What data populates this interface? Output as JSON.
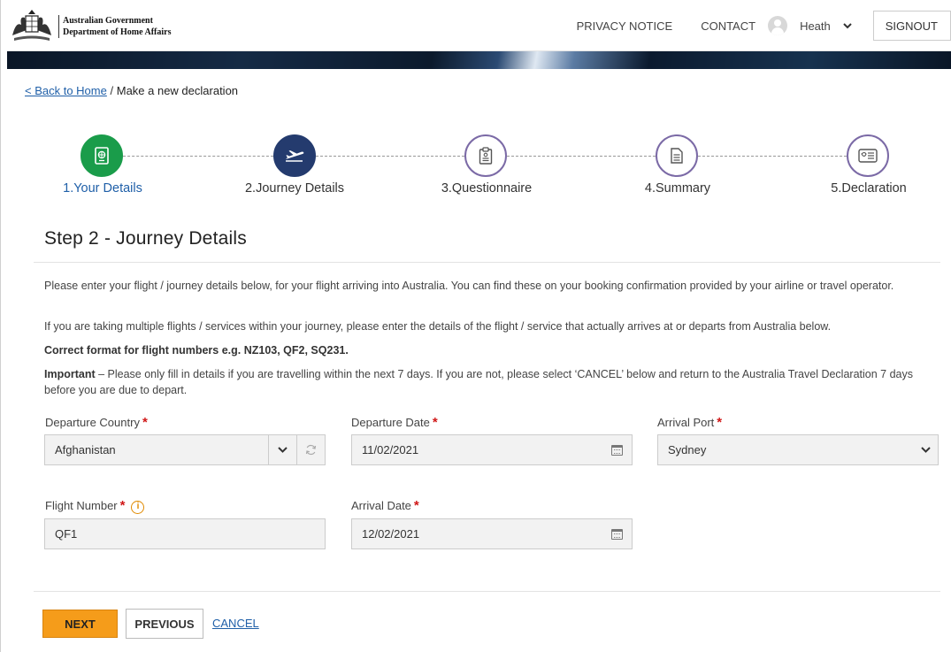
{
  "header": {
    "gov_name": "Australian Government",
    "dept_name": "Department of Home Affairs",
    "privacy_notice": "PRIVACY NOTICE",
    "contact": "CONTACT",
    "user_name": "Heath",
    "signout": "SIGNOUT"
  },
  "breadcrumb": {
    "back_link": "< Back to Home",
    "separator": "/",
    "current": "Make a new declaration"
  },
  "stepper": {
    "steps": [
      {
        "label": "1.Your Details",
        "state": "done",
        "icon": "passport-icon"
      },
      {
        "label": "2.Journey Details",
        "state": "active",
        "icon": "airplane-icon"
      },
      {
        "label": "3.Questionnaire",
        "state": "todo",
        "icon": "clipboard-icon"
      },
      {
        "label": "4.Summary",
        "state": "todo",
        "icon": "document-icon"
      },
      {
        "label": "5.Declaration",
        "state": "todo",
        "icon": "id-card-icon"
      }
    ]
  },
  "page_title": "Step 2 - Journey Details",
  "instructions": {
    "p1": "Please enter your flight / journey details below, for your flight arriving into Australia. You can find these on your booking confirmation provided by your airline or travel operator.",
    "p2": "If you are taking multiple flights / services within your journey, please enter the details of the flight / service that actually arrives at or departs from Australia below.",
    "p3": "Correct format for flight numbers e.g. NZ103, QF2, SQ231.",
    "p4_bold": "Important",
    "p4_rest": " – Please only fill in details if you are travelling within the next 7 days.  If you are not, please select ‘CANCEL’ below and return to the Australia Travel Declaration 7 days before you are due to depart."
  },
  "form": {
    "departure_country": {
      "label": "Departure Country",
      "value": "Afghanistan"
    },
    "departure_date": {
      "label": "Departure Date",
      "value": "11/02/2021"
    },
    "arrival_port": {
      "label": "Arrival Port",
      "value": "Sydney"
    },
    "flight_number": {
      "label": "Flight Number",
      "value": "QF1"
    },
    "arrival_date": {
      "label": "Arrival Date",
      "value": "12/02/2021"
    },
    "required_mark": "*",
    "info_mark": "i"
  },
  "actions": {
    "next": "NEXT",
    "previous": "PREVIOUS",
    "cancel": "CANCEL"
  },
  "colors": {
    "accent_orange": "#f59c1a",
    "step_done": "#1a9c4a",
    "step_active": "#243b6e",
    "step_todo_border": "#7b6aa6",
    "link_blue": "#1f5fa8",
    "required_red": "#d01818"
  }
}
